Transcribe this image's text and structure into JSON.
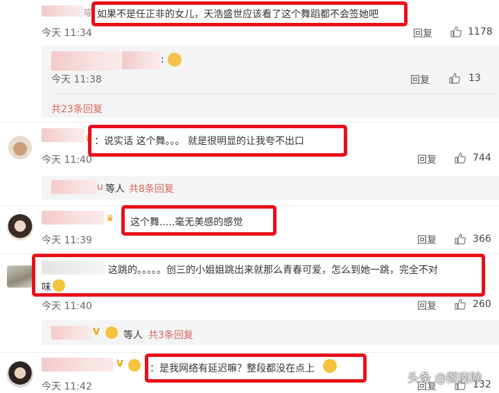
{
  "comments": [
    {
      "text": "如果不是任正非的女儿，天浩盛世应该看了这个舞蹈都不会签她吧",
      "name_suffix": "喵",
      "time": "今天 11:34",
      "reply": "回复",
      "likes": "1178"
    },
    {
      "text": "说实话 这个舞。。。 就是很明显的让我夸不出口",
      "time": "今天 11:40",
      "reply": "回复",
      "likes": "744"
    },
    {
      "text": "这个舞.....毫无美感的感觉",
      "time": "今天 11:39",
      "reply": "回复",
      "likes": "366"
    },
    {
      "text_line1": "这跳的。。。。。创三的小姐姐跳出来就那么青春可爱，怎么到她一跳，完全不对",
      "text_line2": "味",
      "time": "今天 11:40",
      "reply": "回复",
      "likes": "260"
    },
    {
      "text": "是我网络有延迟嘛？整段都没在点上",
      "time": "今天 11:42",
      "reply": "回复",
      "likes": "132"
    }
  ],
  "sub_reply": {
    "text": ":",
    "time": "今天 11:38",
    "reply": "回复",
    "likes": "13",
    "more": "共23条回复"
  },
  "summaries": [
    {
      "name_tail": "u",
      "others": "等人",
      "count": "共8条回复"
    },
    {
      "others": "等人",
      "count": "共3条回复"
    }
  ],
  "watermark": "头条 @图南除",
  "colors": {
    "highlight": "#e8101a",
    "link": "#d4685e"
  }
}
